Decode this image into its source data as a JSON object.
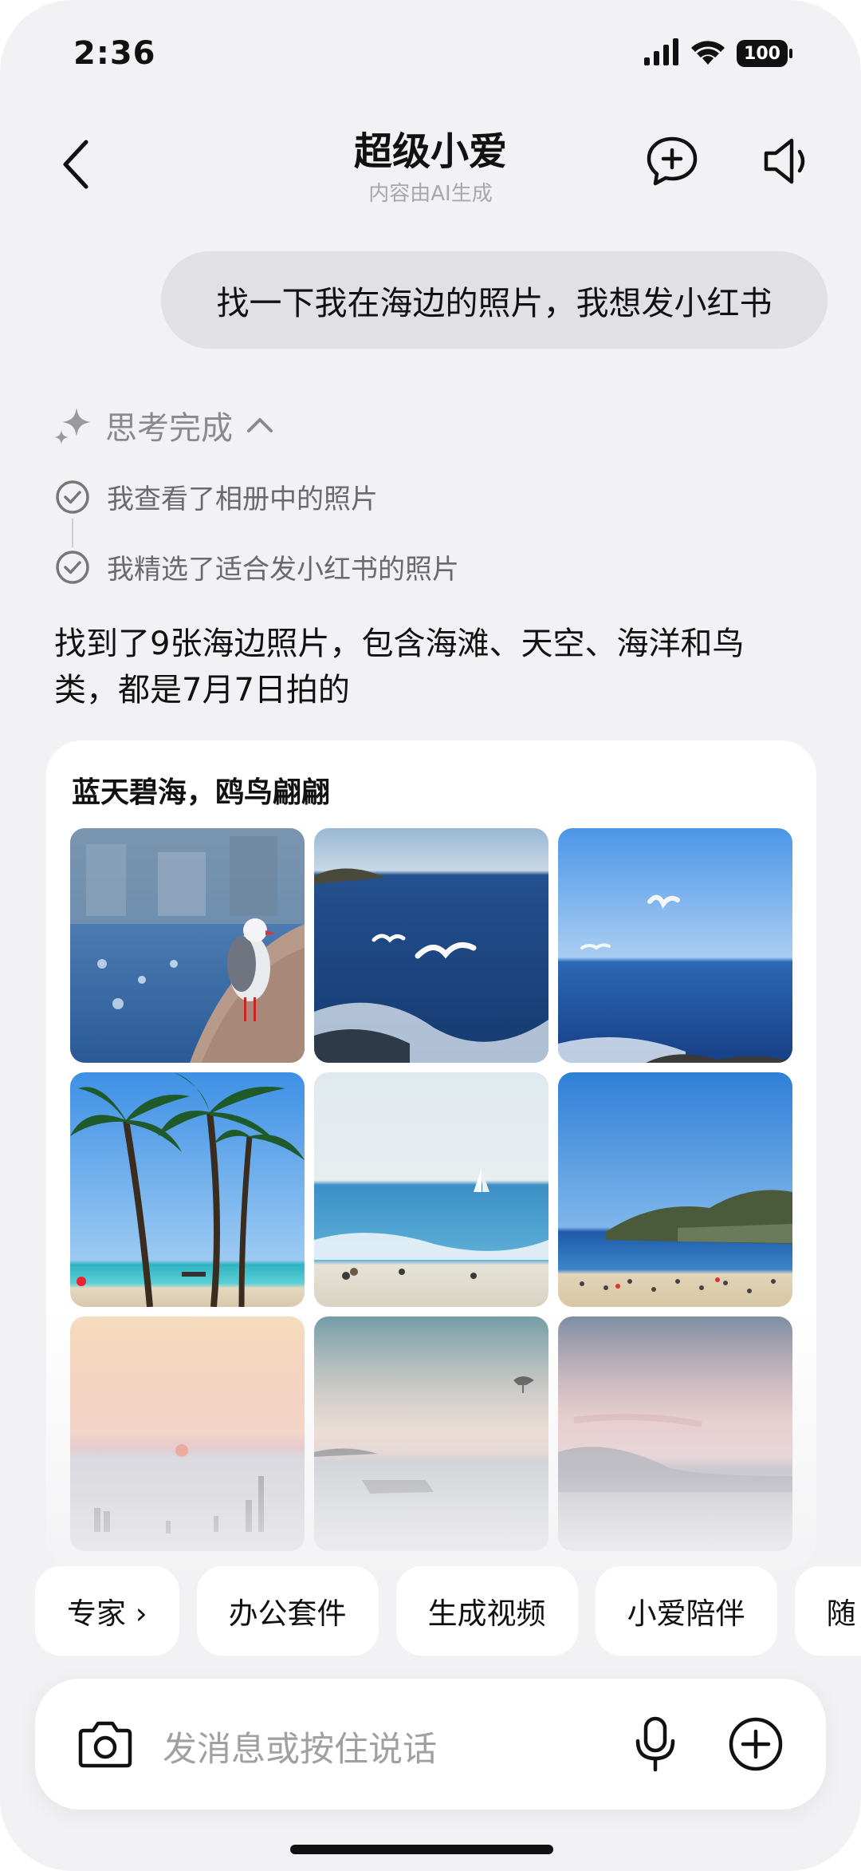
{
  "status_bar": {
    "time": "2:36",
    "battery": "100"
  },
  "header": {
    "title": "超级小爱",
    "subtitle": "内容由AI生成"
  },
  "user_message": "找一下我在海边的照片，我想发小红书",
  "thinking": {
    "label": "思考完成",
    "steps": [
      "我查看了相册中的照片",
      "我精选了适合发小红书的照片"
    ]
  },
  "answer": "找到了9张海边照片，包含海滩、天空、海洋和鸟类，都是7月7日拍的",
  "album": {
    "title": "蓝天碧海，鸥鸟翩翩",
    "photos": [
      "seagull-on-wall",
      "seagulls-over-waves",
      "seagulls-over-open-sea",
      "palm-trees-beach",
      "sailboat-and-waves",
      "coastal-beach-headland",
      "sunset-silhouettes",
      "paraglider-dusk",
      "pink-dusk-hills"
    ]
  },
  "chips": [
    "专家 ›",
    "办公套件",
    "生成视频",
    "小爱陪伴",
    "随"
  ],
  "input": {
    "placeholder": "发消息或按住说话"
  },
  "colors": {
    "background": "#f2f2f4",
    "bubble": "#e1e1e5",
    "card": "#ffffff",
    "accent_text": "#111111",
    "muted": "#8a8a8e"
  }
}
